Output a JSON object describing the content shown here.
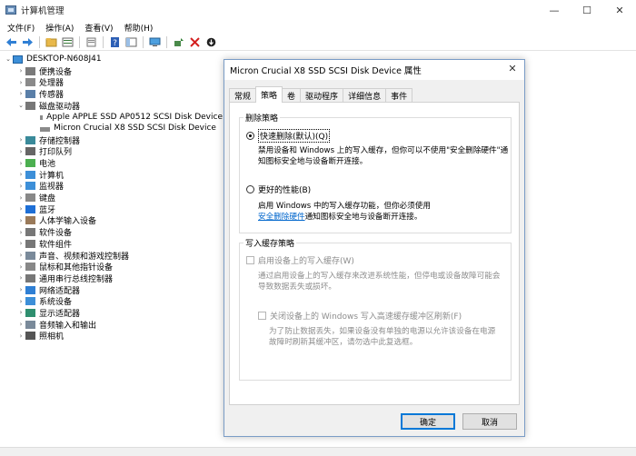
{
  "window": {
    "title": "计算机管理",
    "minimize": "—",
    "maximize": "☐",
    "close": "✕"
  },
  "menu": [
    "文件(F)",
    "操作(A)",
    "查看(V)",
    "帮助(H)"
  ],
  "toolbar_icons": [
    "back-arrow-icon",
    "forward-arrow-icon",
    "folder-icon",
    "list-icon",
    "properties-icon",
    "help-icon",
    "help-pane-icon",
    "monitor-icon",
    "update-driver-icon",
    "uninstall-icon",
    "download-icon"
  ],
  "tree": {
    "root": "DESKTOP-N608J41",
    "items": [
      {
        "label": "便携设备",
        "icon": "portable-device-icon",
        "expanded": false
      },
      {
        "label": "处理器",
        "icon": "processor-icon",
        "expanded": false
      },
      {
        "label": "传感器",
        "icon": "sensor-icon",
        "expanded": false
      },
      {
        "label": "磁盘驱动器",
        "icon": "disk-drive-icon",
        "expanded": true,
        "children": [
          "Apple APPLE SSD AP0512 SCSI Disk Device",
          "Micron Crucial X8 SSD SCSI Disk Device"
        ]
      },
      {
        "label": "存储控制器",
        "icon": "storage-controller-icon",
        "expanded": false
      },
      {
        "label": "打印队列",
        "icon": "printer-queue-icon",
        "expanded": false
      },
      {
        "label": "电池",
        "icon": "battery-icon",
        "expanded": false
      },
      {
        "label": "计算机",
        "icon": "computer-icon",
        "expanded": false
      },
      {
        "label": "监视器",
        "icon": "monitor-icon",
        "expanded": false
      },
      {
        "label": "键盘",
        "icon": "keyboard-icon",
        "expanded": false
      },
      {
        "label": "蓝牙",
        "icon": "bluetooth-icon",
        "expanded": false
      },
      {
        "label": "人体学输入设备",
        "icon": "hid-icon",
        "expanded": false
      },
      {
        "label": "软件设备",
        "icon": "software-device-icon",
        "expanded": false
      },
      {
        "label": "软件组件",
        "icon": "software-component-icon",
        "expanded": false
      },
      {
        "label": "声音、视频和游戏控制器",
        "icon": "sound-icon",
        "expanded": false
      },
      {
        "label": "鼠标和其他指针设备",
        "icon": "mouse-icon",
        "expanded": false
      },
      {
        "label": "通用串行总线控制器",
        "icon": "usb-icon",
        "expanded": false
      },
      {
        "label": "网络适配器",
        "icon": "network-adapter-icon",
        "expanded": false
      },
      {
        "label": "系统设备",
        "icon": "system-device-icon",
        "expanded": false
      },
      {
        "label": "显示适配器",
        "icon": "display-adapter-icon",
        "expanded": false
      },
      {
        "label": "音频输入和输出",
        "icon": "audio-io-icon",
        "expanded": false
      },
      {
        "label": "照相机",
        "icon": "camera-icon",
        "expanded": false
      }
    ]
  },
  "dialog": {
    "title": "Micron Crucial X8 SSD SCSI Disk Device 属性",
    "close": "✕",
    "tabs": [
      "常规",
      "策略",
      "卷",
      "驱动程序",
      "详细信息",
      "事件"
    ],
    "active_tab": "策略",
    "removal_policy": {
      "title": "删除策略",
      "quick_label": "快速删除(默认)(Q)",
      "quick_desc_1": "禁用设备和 Windows 上的写入缓存，但你可以不使用\"安全删除硬件\"通",
      "quick_desc_2": "知图标安全地与设备断开连接。",
      "better_label": "更好的性能(B)",
      "better_desc_1": "启用 Windows 中的写入缓存功能，但你必须使用",
      "better_link": "安全删除硬件",
      "better_desc_2": "通知图标安全地与设备断开连接。"
    },
    "write_cache": {
      "title": "写入缓存策略",
      "enable_label": "启用设备上的写入缓存(W)",
      "enable_desc_1": "通过启用设备上的写入缓存来改进系统性能，但停电或设备故障可能会",
      "enable_desc_2": "导致数据丢失或损坏。",
      "flush_label": "关闭设备上的 Windows 写入高速缓存缓冲区刷新(F)",
      "flush_desc_1": "为了防止数据丢失，如果设备没有单独的电源以允许该设备在电源",
      "flush_desc_2": "故障时刷新其缓冲区，请勿选中此复选框。"
    },
    "ok": "确定",
    "cancel": "取消"
  }
}
